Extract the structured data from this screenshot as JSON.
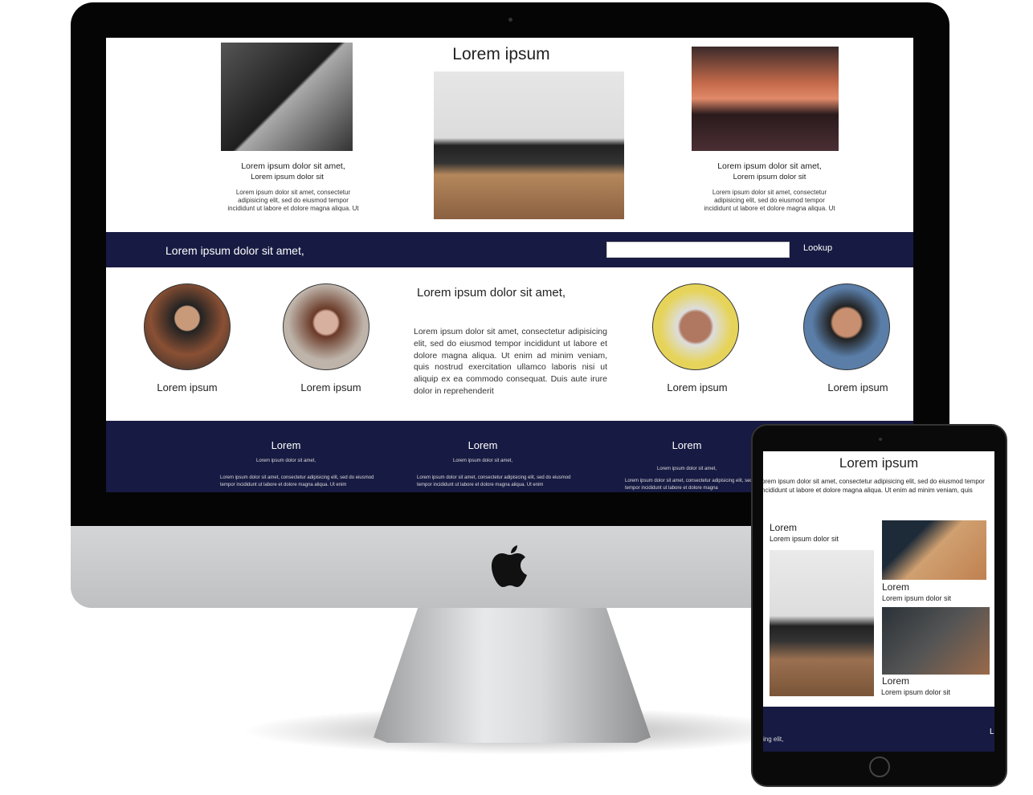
{
  "desktop": {
    "header_title": "Lorem ipsum",
    "cards": [
      {
        "title": "Lorem ipsum dolor sit amet,",
        "subtitle": "Lorem ipsum dolor sit",
        "body": [
          "Lorem ipsum dolor sit amet, consectetur",
          "adipisicing elit, sed do eiusmod tempor",
          "incididunt ut labore et dolore magna aliqua. Ut"
        ]
      },
      {
        "title": "Lorem ipsum dolor sit amet,",
        "subtitle": "Lorem ipsum dolor sit",
        "body": [
          "Lorem ipsum dolor sit amet, consectetur",
          "adipisicing elit, sed do eiusmod tempor",
          "incididunt ut labore et dolore magna aliqua. Ut"
        ]
      }
    ],
    "nav": {
      "text": "Lorem ipsum dolor sit amet,",
      "search_value": "",
      "lookup_label": "Lookup"
    },
    "team": {
      "heading": "Lorem ipsum dolor sit amet,",
      "paragraph": "Lorem ipsum dolor sit amet, consectetur adipisicing elit, sed do eiusmod tempor incididunt ut labore et dolore magna aliqua. Ut enim ad minim veniam, quis nostrud exercitation ullamco laboris nisi ut aliquip ex ea commodo consequat. Duis aute irure dolor in reprehenderit",
      "members": [
        "Lorem ipsum",
        "Lorem ipsum",
        "Lorem ipsum",
        "Lorem ipsum"
      ]
    },
    "footer": [
      {
        "title": "Lorem",
        "subtitle": "Lorem ipsum dolor sit amet,",
        "body": "Lorem ipsum dolor sit amet, consectetur adipisicing elit, sed do eiusmod tempor incididunt ut labore et dolore magna aliqua. Ut enim"
      },
      {
        "title": "Lorem",
        "subtitle": "Lorem ipsum dolor sit amet,",
        "body": "Lorem ipsum dolor sit amet, consectetur adipisicing elit, sed do eiusmod tempor incididunt ut labore et dolore magna aliqua. Ut enim"
      },
      {
        "title": "Lorem",
        "subtitle": "Lorem ipsum dolor sit amet,",
        "body": "Lorem ipsum dolor sit amet, consectetur adipisicing elit, sed do eiusmod tempor incididunt ut labore et dolore magna"
      }
    ]
  },
  "tablet": {
    "title": "Lorem ipsum",
    "intro": [
      "orem ipsum dolor sit amet, consectetur adipisicing elit, sed do eiusmod tempor",
      "ncididunt ut labore et dolore magna aliqua. Ut enim ad minim veniam, quis"
    ],
    "items": [
      {
        "title": "Lorem",
        "subtitle": "Lorem ipsum dolor sit"
      },
      {
        "title": "Lorem",
        "subtitle": "Lorem ipsum dolor sit"
      },
      {
        "title": "Lorem",
        "subtitle": "Lorem ipsum dolor sit"
      }
    ],
    "footer_text": "ing elit,",
    "footer_letter": "L"
  },
  "colors": {
    "navy": "#171a42"
  }
}
